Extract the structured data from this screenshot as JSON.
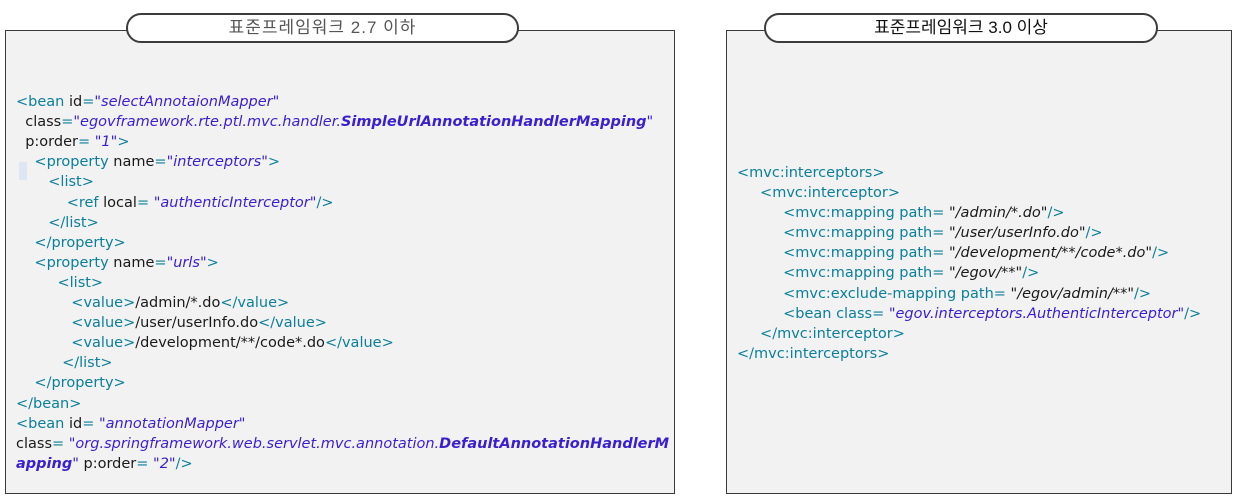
{
  "left_panel": {
    "title": "표준프레임워크 2.7 이하",
    "lines": [
      [],
      [
        {
          "t": "<bean ",
          "c": "tag"
        },
        {
          "t": "id",
          "c": "attr-plain"
        },
        {
          "t": "=",
          "c": "tag"
        },
        {
          "t": "\"selectAnnotaionMapper\"",
          "c": "val"
        }
      ],
      [
        {
          "t": "  class",
          "c": "attr-plain"
        },
        {
          "t": "=",
          "c": "tag"
        },
        {
          "t": "\"egovframework.rte.ptl.mvc.handler.",
          "c": "val"
        },
        {
          "t": "SimpleUrlAnnotationHandlerMapping",
          "c": "val-bold"
        },
        {
          "t": "\"",
          "c": "val"
        }
      ],
      [
        {
          "t": "  p:order",
          "c": "attr-plain"
        },
        {
          "t": "=",
          "c": "tag"
        },
        {
          "t": " \"1\"",
          "c": "val"
        },
        {
          "t": ">",
          "c": "tag"
        }
      ],
      [
        {
          "t": "    <property ",
          "c": "tag"
        },
        {
          "t": "name",
          "c": "attr-plain"
        },
        {
          "t": "=",
          "c": "tag"
        },
        {
          "t": "\"interceptors\"",
          "c": "val"
        },
        {
          "t": ">",
          "c": "tag"
        }
      ],
      [
        {
          "t": "       <list>",
          "c": "tag"
        }
      ],
      [
        {
          "t": "           <ref ",
          "c": "tag"
        },
        {
          "t": "local",
          "c": "attr-plain"
        },
        {
          "t": "=",
          "c": "tag"
        },
        {
          "t": " \"authenticInterceptor\"",
          "c": "val"
        },
        {
          "t": "/>",
          "c": "tag"
        }
      ],
      [
        {
          "t": "       </list>",
          "c": "tag"
        }
      ],
      [
        {
          "t": "    </property>",
          "c": "tag"
        }
      ],
      [
        {
          "t": "    <property ",
          "c": "tag"
        },
        {
          "t": "name",
          "c": "attr-plain"
        },
        {
          "t": "=",
          "c": "tag"
        },
        {
          "t": "\"urls\"",
          "c": "val"
        },
        {
          "t": ">",
          "c": "tag"
        }
      ],
      [
        {
          "t": "         <list>",
          "c": "tag"
        }
      ],
      [
        {
          "t": "            <value>",
          "c": "tag"
        },
        {
          "t": "/admin/*.do",
          "c": "txt"
        },
        {
          "t": "</value>",
          "c": "tag"
        }
      ],
      [
        {
          "t": "            <value>",
          "c": "tag"
        },
        {
          "t": "/user/userInfo.do",
          "c": "txt"
        },
        {
          "t": "</value>",
          "c": "tag"
        }
      ],
      [
        {
          "t": "            <value>",
          "c": "tag"
        },
        {
          "t": "/development/**/code*.do",
          "c": "txt"
        },
        {
          "t": "</value>",
          "c": "tag"
        }
      ],
      [
        {
          "t": "          </list>",
          "c": "tag"
        }
      ],
      [
        {
          "t": "    </property>",
          "c": "tag"
        }
      ],
      [
        {
          "t": "</bean>",
          "c": "tag"
        }
      ],
      [
        {
          "t": "<bean ",
          "c": "tag"
        },
        {
          "t": "id",
          "c": "attr-plain"
        },
        {
          "t": "=",
          "c": "tag"
        },
        {
          "t": " \"annotationMapper\"",
          "c": "val"
        }
      ],
      [
        {
          "t": "class",
          "c": "attr-plain"
        },
        {
          "t": "=",
          "c": "tag"
        },
        {
          "t": " \"org.springframework.web.servlet.mvc.annotation.",
          "c": "val"
        },
        {
          "t": "DefaultAnnotationHandlerM",
          "c": "val-bold"
        }
      ],
      [
        {
          "t": "apping",
          "c": "val-bold"
        },
        {
          "t": "\"",
          "c": "val"
        },
        {
          "t": " p:order",
          "c": "attr-plain"
        },
        {
          "t": "=",
          "c": "tag"
        },
        {
          "t": " \"2\"",
          "c": "val"
        },
        {
          "t": "/>",
          "c": "tag"
        }
      ]
    ]
  },
  "right_panel": {
    "title": "표준프레임워크 3.0 이상",
    "lines": [
      [
        {
          "t": "<mvc:interceptors>",
          "c": "tag"
        }
      ],
      [
        {
          "t": "     <mvc:interceptor>",
          "c": "tag"
        }
      ],
      [
        {
          "t": "          <mvc:mapping ",
          "c": "tag"
        },
        {
          "t": "path",
          "c": "tag"
        },
        {
          "t": "=",
          "c": "tag"
        },
        {
          "t": " \"/admin/*.do\"",
          "c": "val-black"
        },
        {
          "t": "/>",
          "c": "tag"
        }
      ],
      [
        {
          "t": "          <mvc:mapping ",
          "c": "tag"
        },
        {
          "t": "path",
          "c": "tag"
        },
        {
          "t": "=",
          "c": "tag"
        },
        {
          "t": " \"/user/userInfo.do\"",
          "c": "val-black"
        },
        {
          "t": "/>",
          "c": "tag"
        }
      ],
      [
        {
          "t": "          <mvc:mapping ",
          "c": "tag"
        },
        {
          "t": "path",
          "c": "tag"
        },
        {
          "t": "=",
          "c": "tag"
        },
        {
          "t": " \"/development/**/code*.do\"",
          "c": "val-black"
        },
        {
          "t": "/>",
          "c": "tag"
        }
      ],
      [
        {
          "t": "          <mvc:mapping ",
          "c": "tag"
        },
        {
          "t": "path",
          "c": "tag"
        },
        {
          "t": "=",
          "c": "tag"
        },
        {
          "t": " \"/egov/**\"",
          "c": "val-black"
        },
        {
          "t": "/>",
          "c": "tag"
        }
      ],
      [
        {
          "t": "          <mvc:exclude-mapping ",
          "c": "tag"
        },
        {
          "t": "path",
          "c": "tag"
        },
        {
          "t": "=",
          "c": "tag"
        },
        {
          "t": " \"/egov/admin/**\"",
          "c": "val-black"
        },
        {
          "t": "/>",
          "c": "tag"
        }
      ],
      [
        {
          "t": "          <bean ",
          "c": "tag"
        },
        {
          "t": "class",
          "c": "tag"
        },
        {
          "t": "=",
          "c": "tag"
        },
        {
          "t": " \"egov.interceptors.AuthenticInterceptor\"",
          "c": "val"
        },
        {
          "t": "/>",
          "c": "tag"
        }
      ],
      [
        {
          "t": "     </mvc:interceptor>",
          "c": "tag"
        }
      ],
      [
        {
          "t": "</mvc:interceptors>",
          "c": "tag"
        }
      ]
    ]
  }
}
